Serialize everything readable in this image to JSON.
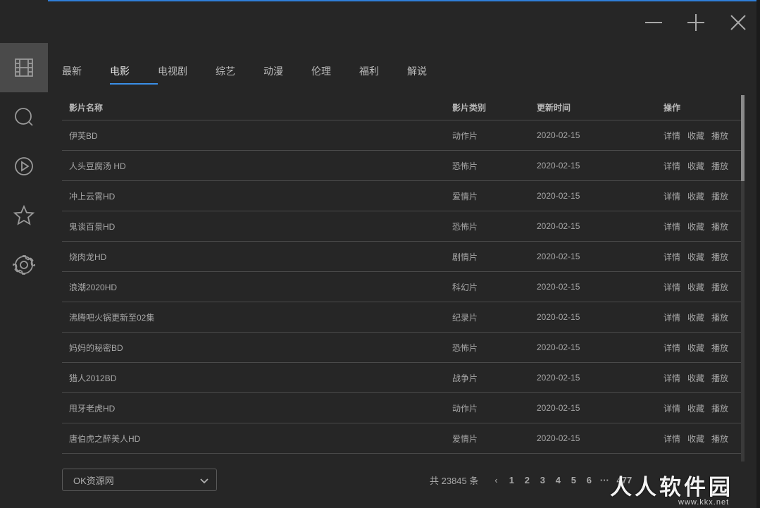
{
  "tabs": [
    "最新",
    "电影",
    "电视剧",
    "综艺",
    "动漫",
    "伦理",
    "福利",
    "解说"
  ],
  "active_tab": 1,
  "table": {
    "headers": {
      "name": "影片名称",
      "type": "影片类别",
      "time": "更新时间",
      "ops": "操作"
    },
    "ops": {
      "detail": "详情",
      "collect": "收藏",
      "play": "播放"
    },
    "rows": [
      {
        "name": "伊芙BD",
        "type": "动作片",
        "time": "2020-02-15"
      },
      {
        "name": "人头豆腐汤 HD",
        "type": "恐怖片",
        "time": "2020-02-15"
      },
      {
        "name": "冲上云霄HD",
        "type": "爱情片",
        "time": "2020-02-15"
      },
      {
        "name": "鬼谈百景HD",
        "type": "恐怖片",
        "time": "2020-02-15"
      },
      {
        "name": "烧肉龙HD",
        "type": "剧情片",
        "time": "2020-02-15"
      },
      {
        "name": "浪潮2020HD",
        "type": "科幻片",
        "time": "2020-02-15"
      },
      {
        "name": "沸腾吧火锅更新至02集",
        "type": "纪录片",
        "time": "2020-02-15"
      },
      {
        "name": "妈妈的秘密BD",
        "type": "恐怖片",
        "time": "2020-02-15"
      },
      {
        "name": "猎人2012BD",
        "type": "战争片",
        "time": "2020-02-15"
      },
      {
        "name": "甩牙老虎HD",
        "type": "动作片",
        "time": "2020-02-15"
      },
      {
        "name": "唐伯虎之醉美人HD",
        "type": "爱情片",
        "time": "2020-02-15"
      }
    ]
  },
  "source_select": {
    "value": "OK资源网"
  },
  "pager": {
    "total": "共 23845 条",
    "prev": "‹",
    "pages": [
      "1",
      "2",
      "3",
      "4",
      "5",
      "6",
      "···",
      "477"
    ]
  },
  "watermark": {
    "main": "人人软件园",
    "url": "www.kkx.net"
  },
  "sidebar_icons": [
    "film-icon",
    "search-icon",
    "play-icon",
    "star-icon",
    "settings-icon"
  ],
  "colors": {
    "background": "#262626",
    "accent": "#3a8ee6",
    "sidebar_active": "#4a4a4a"
  }
}
